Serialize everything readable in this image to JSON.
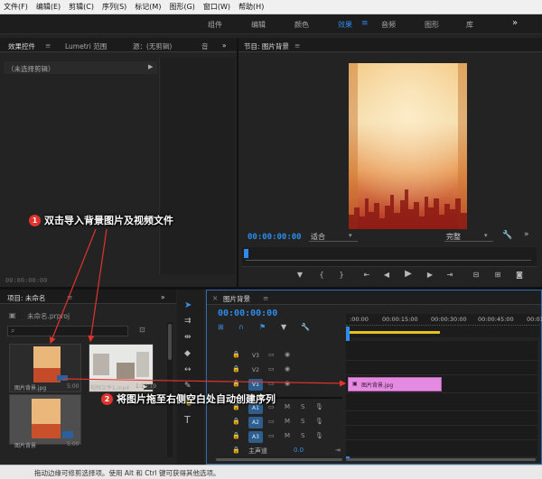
{
  "menubar": {
    "items": [
      "文件(F)",
      "编辑(E)",
      "剪辑(C)",
      "序列(S)",
      "标记(M)",
      "图形(G)",
      "窗口(W)",
      "帮助(H)"
    ]
  },
  "workspaces": {
    "items": [
      "组件",
      "编辑",
      "颜色",
      "效果",
      "音频",
      "图形",
      "库"
    ],
    "active": "效果",
    "more": "»"
  },
  "effect_controls": {
    "tabs": [
      "效果控件",
      "Lumetri 范围",
      "源：(无剪辑)",
      "音"
    ],
    "no_clip": "（未选择剪辑）",
    "timecode": "00:00:00:00"
  },
  "program": {
    "title": "节目: 图片背景",
    "timecode": "00:00:00:00",
    "zoom": "适合",
    "quality": "完整",
    "colors": {
      "preview_top": "#f3c882",
      "preview_mid": "#e89a55",
      "preview_bottom": "#b02a1e"
    }
  },
  "project": {
    "title": "项目: 未命名",
    "file": "未命名.prproj",
    "items": [
      {
        "name": "图片背景.jpg",
        "duration": "5:00"
      },
      {
        "name": "视频文件1.mp4",
        "duration": "1:10:19"
      },
      {
        "name": "图片背景",
        "duration": "5:00"
      }
    ]
  },
  "timeline": {
    "title": "图片背景",
    "timecode": "00:00:00:00",
    "ruler": [
      ":00:00",
      "00:00:15:00",
      "00:00:30:00",
      "00:00:45:00",
      "00:01"
    ],
    "video_tracks": [
      "V3",
      "V2",
      "V1"
    ],
    "audio_tracks": [
      "A1",
      "A2",
      "A3"
    ],
    "master": "主声道",
    "master_value": "0.0",
    "m_label": "M",
    "s_label": "S",
    "clip_label": "图片背景.jpg",
    "clip_color": "#e48ae0"
  },
  "tools": [
    "selection",
    "track-select",
    "ripple",
    "razor",
    "slip",
    "pen",
    "hand",
    "type"
  ],
  "annotations": [
    {
      "number": "1",
      "text": "双击导入背景图片及视频文件"
    },
    {
      "number": "2",
      "text": "将图片拖至右侧空白处自动创建序列"
    }
  ],
  "status": "拖动边缘可修剪选择项。使用 Alt 和 Ctrl 键可获得其他选项。"
}
